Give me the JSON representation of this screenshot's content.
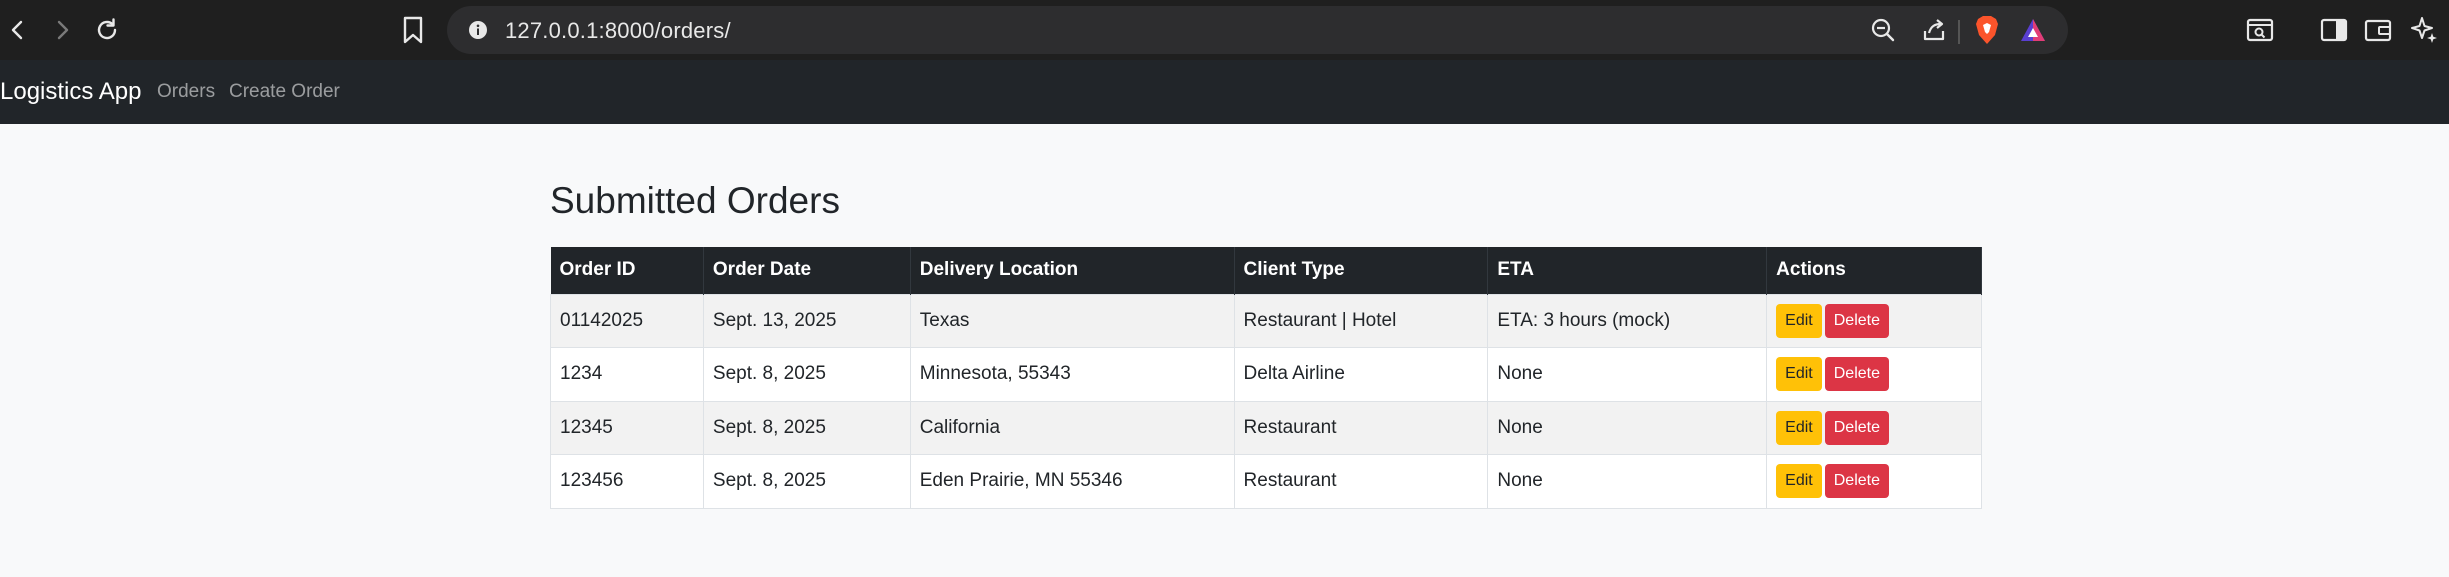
{
  "browser": {
    "url": "127.0.0.1:8000/orders/",
    "icons": [
      "back-icon",
      "forward-icon",
      "reload-icon",
      "bookmark-icon",
      "site-info-icon",
      "zoom-out-icon",
      "share-icon",
      "brave-shields-icon",
      "brave-rewards-icon",
      "tab-search-icon",
      "sidebar-icon",
      "wallet-icon",
      "leo-ai-icon"
    ],
    "colors": {
      "chrome": "#1f1f1f",
      "urlbar": "#2d2d2f",
      "brave_orange": "#fb542b"
    }
  },
  "navbar": {
    "brand": "Logistics App",
    "links": [
      "Orders",
      "Create Order"
    ],
    "colors": {
      "background": "#212529"
    }
  },
  "main": {
    "title": "Submitted Orders",
    "table": {
      "columns": [
        "Order ID",
        "Order Date",
        "Delivery Location",
        "Client Type",
        "ETA",
        "Actions"
      ],
      "rows": [
        {
          "order_id": "01142025",
          "order_date": "Sept. 13, 2025",
          "location": "Texas",
          "client_type": "Restaurant | Hotel",
          "eta": "ETA: 3 hours (mock)"
        },
        {
          "order_id": "1234",
          "order_date": "Sept. 8, 2025",
          "location": "Minnesota, 55343",
          "client_type": "Delta Airline",
          "eta": "None"
        },
        {
          "order_id": "12345",
          "order_date": "Sept. 8, 2025",
          "location": "California",
          "client_type": "Restaurant",
          "eta": "None"
        },
        {
          "order_id": "123456",
          "order_date": "Sept. 8, 2025",
          "location": "Eden Prairie, MN 55346",
          "client_type": "Restaurant",
          "eta": "None"
        }
      ],
      "actions": {
        "edit_label": "Edit",
        "delete_label": "Delete"
      }
    },
    "colors": {
      "edit": "#ffc107",
      "delete": "#dc3545",
      "header": "#212529"
    }
  }
}
